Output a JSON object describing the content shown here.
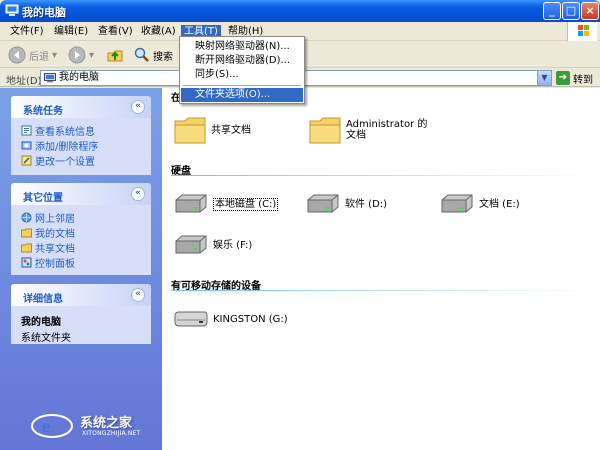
{
  "window": {
    "title": "我的电脑"
  },
  "menubar": [
    {
      "label": "文件(F)"
    },
    {
      "label": "编辑(E)"
    },
    {
      "label": "查看(V)"
    },
    {
      "label": "收藏(A)"
    },
    {
      "label": "工具(T)"
    },
    {
      "label": "帮助(H)"
    }
  ],
  "tools_menu": {
    "items": [
      {
        "label": "映射网络驱动器(N)..."
      },
      {
        "label": "断开网络驱动器(D)..."
      },
      {
        "label": "同步(S)..."
      },
      {
        "label": "文件夹选项(O)..."
      }
    ]
  },
  "toolbar": {
    "back_label": "后退",
    "search_label": "搜索"
  },
  "address": {
    "label": "地址(D)",
    "value": "我的电脑",
    "go_label": "转到"
  },
  "left": {
    "system_tasks": {
      "title": "系统任务",
      "items": [
        {
          "label": "查看系统信息"
        },
        {
          "label": "添加/删除程序"
        },
        {
          "label": "更改一个设置"
        }
      ]
    },
    "other_places": {
      "title": "其它位置",
      "items": [
        {
          "label": "网上邻居"
        },
        {
          "label": "我的文档"
        },
        {
          "label": "共享文档"
        },
        {
          "label": "控制面板"
        }
      ]
    },
    "details": {
      "title": "详细信息",
      "name": "我的电脑",
      "subtitle": "系统文件夹"
    }
  },
  "main": {
    "sections": {
      "files_partial": "在",
      "hard_disks": "硬盘",
      "removable": "有可移动存储的设备"
    },
    "folders": [
      {
        "label": "共享文档"
      },
      {
        "label": "Administrator 的文档"
      }
    ],
    "drives": [
      {
        "label": "本地磁盘 (C:)"
      },
      {
        "label": "软件 (D:)"
      },
      {
        "label": "文档 (E:)"
      },
      {
        "label": "娱乐 (F:)"
      }
    ],
    "removable": [
      {
        "label": "KINGSTON (G:)"
      }
    ]
  },
  "watermark": {
    "text": "系统之家",
    "sub": "XITONGZHIJIA.NET"
  },
  "colors": {
    "titlebar": "#0553d6",
    "task_link": "#215dc6",
    "highlight": "#316ac5"
  }
}
